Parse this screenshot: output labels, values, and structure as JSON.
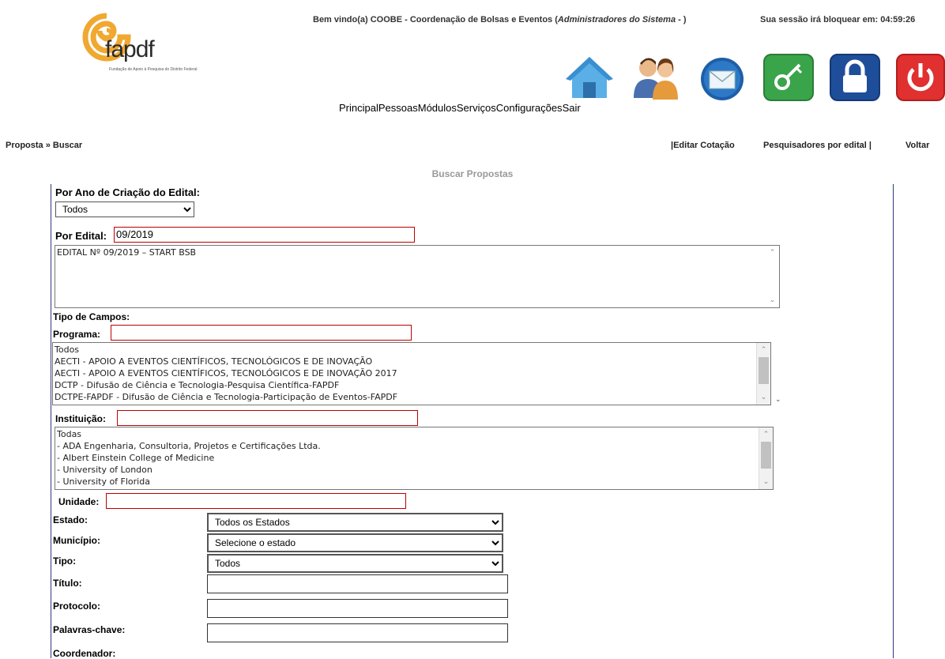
{
  "header": {
    "logo_text": "fapdf",
    "logo_subtitle": "Fundação de Apoio à Pesquisa do Distrito Federal",
    "welcome_prefix": "Bem vindo(a) COOBE - Coordenação de Bolsas e Eventos (",
    "welcome_role": "Administradores do Sistema",
    "welcome_suffix": " - )",
    "session_text": "Sua sessão irá bloquear em: 04:59:26",
    "nav": [
      "Principal",
      "Pessoas",
      "Módulos",
      "Serviços",
      "Configurações",
      "Sair"
    ],
    "icons": [
      "home-icon",
      "people-icon",
      "mail-icon",
      "key-icon",
      "lock-icon",
      "power-icon"
    ]
  },
  "breadcrumb": "Proposta » Buscar",
  "toplinks": {
    "editar": "|Editar Cotação",
    "pesquisadores": "Pesquisadores por edital |",
    "voltar": "Voltar"
  },
  "section_title": "Buscar Propostas",
  "form": {
    "ano_label": "Por Ano de Criação do Edital:",
    "ano_value": "Todos",
    "edital_label": "Por Edital:",
    "edital_value": "09/2019",
    "edital_options": [
      "EDITAL Nº 09/2019 – START BSB"
    ],
    "tipo_campos_label": "Tipo de Campos:",
    "programa_label": "Programa:",
    "programa_value": "",
    "programa_options": [
      "Todos",
      "AECTI - APOIO A EVENTOS CIENTÍFICOS, TECNOLÓGICOS E DE INOVAÇÃO",
      "AECTI - APOIO A EVENTOS CIENTÍFICOS, TECNOLÓGICOS E DE INOVAÇÃO 2017",
      "DCTP - Difusão de Ciência e Tecnologia-Pesquisa Científica-FAPDF",
      "DCTPE-FAPDF - Difusão de Ciência e Tecnologia-Participação de Eventos-FAPDF"
    ],
    "instituicao_label": "Instituição:",
    "instituicao_value": "",
    "instituicao_options": [
      "Todas",
      "- ADA Engenharia, Consultoria, Projetos e Certificações Ltda.",
      "- Albert Einstein College of Medicine",
      "- University of London",
      "- University of Florida"
    ],
    "unidade_label": "Unidade:",
    "unidade_value": "",
    "estado_label": "Estado:",
    "estado_value": "Todos os Estados",
    "municipio_label": "Município:",
    "municipio_value": "Selecione o estado",
    "tipo_label": "Tipo:",
    "tipo_value": "Todos",
    "titulo_label": "Título:",
    "protocolo_label": "Protocolo:",
    "palavras_label": "Palavras-chave:",
    "coordenador_label": "Coordenador:"
  }
}
